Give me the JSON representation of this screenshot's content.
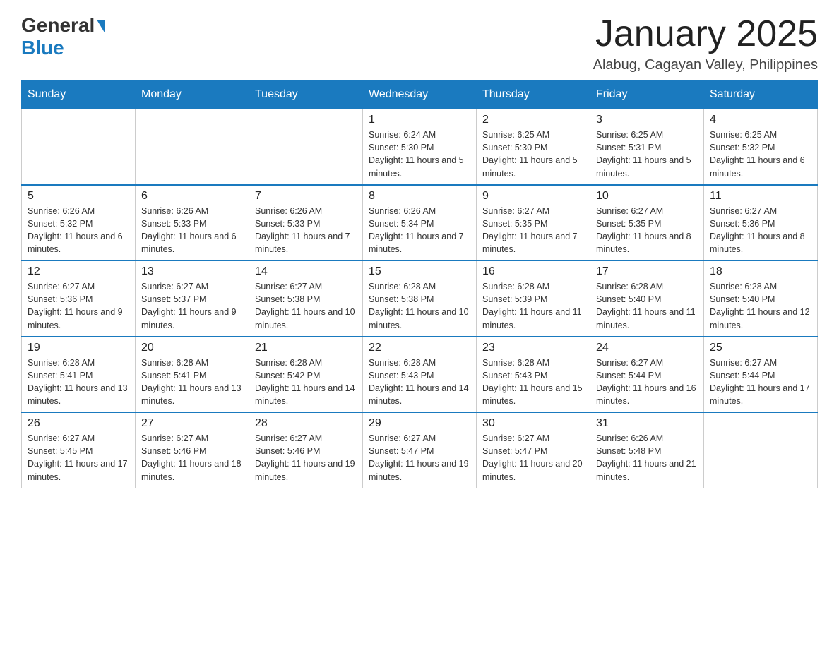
{
  "header": {
    "title": "January 2025",
    "location": "Alabug, Cagayan Valley, Philippines",
    "logo_general": "General",
    "logo_blue": "Blue"
  },
  "days_of_week": [
    "Sunday",
    "Monday",
    "Tuesday",
    "Wednesday",
    "Thursday",
    "Friday",
    "Saturday"
  ],
  "weeks": [
    {
      "days": [
        {
          "num": "",
          "info": ""
        },
        {
          "num": "",
          "info": ""
        },
        {
          "num": "",
          "info": ""
        },
        {
          "num": "1",
          "info": "Sunrise: 6:24 AM\nSunset: 5:30 PM\nDaylight: 11 hours and 5 minutes."
        },
        {
          "num": "2",
          "info": "Sunrise: 6:25 AM\nSunset: 5:30 PM\nDaylight: 11 hours and 5 minutes."
        },
        {
          "num": "3",
          "info": "Sunrise: 6:25 AM\nSunset: 5:31 PM\nDaylight: 11 hours and 5 minutes."
        },
        {
          "num": "4",
          "info": "Sunrise: 6:25 AM\nSunset: 5:32 PM\nDaylight: 11 hours and 6 minutes."
        }
      ]
    },
    {
      "days": [
        {
          "num": "5",
          "info": "Sunrise: 6:26 AM\nSunset: 5:32 PM\nDaylight: 11 hours and 6 minutes."
        },
        {
          "num": "6",
          "info": "Sunrise: 6:26 AM\nSunset: 5:33 PM\nDaylight: 11 hours and 6 minutes."
        },
        {
          "num": "7",
          "info": "Sunrise: 6:26 AM\nSunset: 5:33 PM\nDaylight: 11 hours and 7 minutes."
        },
        {
          "num": "8",
          "info": "Sunrise: 6:26 AM\nSunset: 5:34 PM\nDaylight: 11 hours and 7 minutes."
        },
        {
          "num": "9",
          "info": "Sunrise: 6:27 AM\nSunset: 5:35 PM\nDaylight: 11 hours and 7 minutes."
        },
        {
          "num": "10",
          "info": "Sunrise: 6:27 AM\nSunset: 5:35 PM\nDaylight: 11 hours and 8 minutes."
        },
        {
          "num": "11",
          "info": "Sunrise: 6:27 AM\nSunset: 5:36 PM\nDaylight: 11 hours and 8 minutes."
        }
      ]
    },
    {
      "days": [
        {
          "num": "12",
          "info": "Sunrise: 6:27 AM\nSunset: 5:36 PM\nDaylight: 11 hours and 9 minutes."
        },
        {
          "num": "13",
          "info": "Sunrise: 6:27 AM\nSunset: 5:37 PM\nDaylight: 11 hours and 9 minutes."
        },
        {
          "num": "14",
          "info": "Sunrise: 6:27 AM\nSunset: 5:38 PM\nDaylight: 11 hours and 10 minutes."
        },
        {
          "num": "15",
          "info": "Sunrise: 6:28 AM\nSunset: 5:38 PM\nDaylight: 11 hours and 10 minutes."
        },
        {
          "num": "16",
          "info": "Sunrise: 6:28 AM\nSunset: 5:39 PM\nDaylight: 11 hours and 11 minutes."
        },
        {
          "num": "17",
          "info": "Sunrise: 6:28 AM\nSunset: 5:40 PM\nDaylight: 11 hours and 11 minutes."
        },
        {
          "num": "18",
          "info": "Sunrise: 6:28 AM\nSunset: 5:40 PM\nDaylight: 11 hours and 12 minutes."
        }
      ]
    },
    {
      "days": [
        {
          "num": "19",
          "info": "Sunrise: 6:28 AM\nSunset: 5:41 PM\nDaylight: 11 hours and 13 minutes."
        },
        {
          "num": "20",
          "info": "Sunrise: 6:28 AM\nSunset: 5:41 PM\nDaylight: 11 hours and 13 minutes."
        },
        {
          "num": "21",
          "info": "Sunrise: 6:28 AM\nSunset: 5:42 PM\nDaylight: 11 hours and 14 minutes."
        },
        {
          "num": "22",
          "info": "Sunrise: 6:28 AM\nSunset: 5:43 PM\nDaylight: 11 hours and 14 minutes."
        },
        {
          "num": "23",
          "info": "Sunrise: 6:28 AM\nSunset: 5:43 PM\nDaylight: 11 hours and 15 minutes."
        },
        {
          "num": "24",
          "info": "Sunrise: 6:27 AM\nSunset: 5:44 PM\nDaylight: 11 hours and 16 minutes."
        },
        {
          "num": "25",
          "info": "Sunrise: 6:27 AM\nSunset: 5:44 PM\nDaylight: 11 hours and 17 minutes."
        }
      ]
    },
    {
      "days": [
        {
          "num": "26",
          "info": "Sunrise: 6:27 AM\nSunset: 5:45 PM\nDaylight: 11 hours and 17 minutes."
        },
        {
          "num": "27",
          "info": "Sunrise: 6:27 AM\nSunset: 5:46 PM\nDaylight: 11 hours and 18 minutes."
        },
        {
          "num": "28",
          "info": "Sunrise: 6:27 AM\nSunset: 5:46 PM\nDaylight: 11 hours and 19 minutes."
        },
        {
          "num": "29",
          "info": "Sunrise: 6:27 AM\nSunset: 5:47 PM\nDaylight: 11 hours and 19 minutes."
        },
        {
          "num": "30",
          "info": "Sunrise: 6:27 AM\nSunset: 5:47 PM\nDaylight: 11 hours and 20 minutes."
        },
        {
          "num": "31",
          "info": "Sunrise: 6:26 AM\nSunset: 5:48 PM\nDaylight: 11 hours and 21 minutes."
        },
        {
          "num": "",
          "info": ""
        }
      ]
    }
  ]
}
